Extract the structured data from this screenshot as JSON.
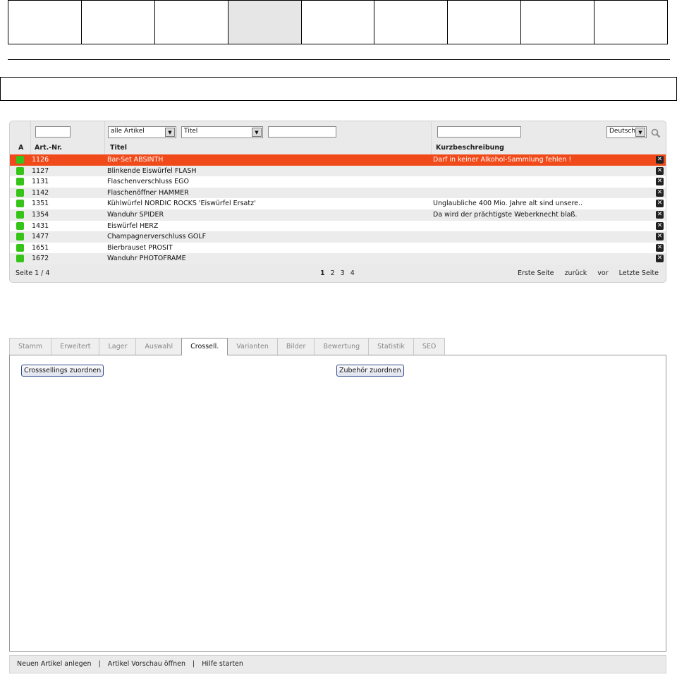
{
  "toolbar": {
    "box_count": 9,
    "active_index": 3
  },
  "list": {
    "filters": {
      "artnr": "",
      "article_type": "alle Artikel",
      "title_field": "Titel",
      "title_search": "",
      "desc_search": "",
      "language": "Deutsch"
    },
    "headers": {
      "active": "A",
      "artnr": "Art.-Nr.",
      "title": "Titel",
      "desc": "Kurzbeschreibung"
    },
    "rows": [
      {
        "nr": "1126",
        "title": "Bar-Set ABSINTH",
        "desc": "Darf in keiner Alkohol-Sammlung fehlen !",
        "selected": true
      },
      {
        "nr": "1127",
        "title": "Blinkende Eiswürfel FLASH",
        "desc": ""
      },
      {
        "nr": "1131",
        "title": "Flaschenverschluss EGO",
        "desc": ""
      },
      {
        "nr": "1142",
        "title": "Flaschenöffner HAMMER",
        "desc": ""
      },
      {
        "nr": "1351",
        "title": "Kühlwürfel NORDIC ROCKS 'Eiswürfel Ersatz'",
        "desc": "Unglaubliche 400 Mio. Jahre alt sind unsere.."
      },
      {
        "nr": "1354",
        "title": "Wanduhr SPIDER",
        "desc": "Da wird der prächtigste Weberknecht blaß."
      },
      {
        "nr": "1431",
        "title": "Eiswürfel HERZ",
        "desc": ""
      },
      {
        "nr": "1477",
        "title": "Champagnerverschluss GOLF",
        "desc": ""
      },
      {
        "nr": "1651",
        "title": "Bierbrauset PROSIT",
        "desc": ""
      },
      {
        "nr": "1672",
        "title": "Wanduhr PHOTOFRAME",
        "desc": ""
      }
    ],
    "footer": {
      "page_info": "Seite 1 / 4",
      "pages": [
        "1",
        "2",
        "3",
        "4"
      ],
      "first": "Erste Seite",
      "back": "zurück",
      "forward": "vor",
      "last": "Letzte Seite"
    }
  },
  "tabs": [
    "Stamm",
    "Erweitert",
    "Lager",
    "Auswahl",
    "Crossell.",
    "Varianten",
    "Bilder",
    "Bewertung",
    "Statistik",
    "SEO"
  ],
  "active_tab": "Crossell.",
  "panel": {
    "crossselling_button": "Crosssellings zuordnen",
    "accessory_button": "Zubehör zuordnen"
  },
  "bottom": {
    "new_article": "Neuen Artikel anlegen",
    "preview": "Artikel Vorschau öffnen",
    "help": "Hilfe starten",
    "sep": "|"
  },
  "colors": {
    "selected_row": "#f14a1a",
    "active_dot": "#35c417"
  }
}
